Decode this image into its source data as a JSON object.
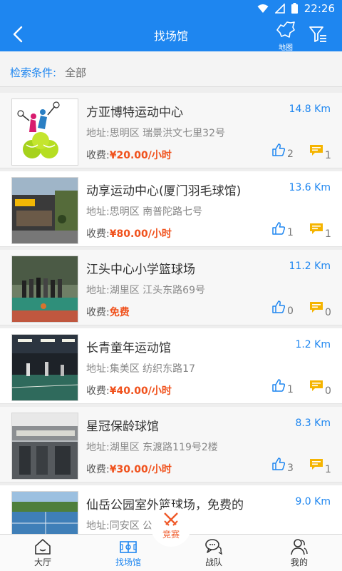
{
  "status_bar": {
    "time": "22:26",
    "icons": [
      "wifi-icon",
      "signal-icon",
      "battery-icon"
    ]
  },
  "header": {
    "title": "找场馆",
    "map_label": "地图",
    "back_icon": "back-arrow-icon",
    "filter_icon": "filter-icon"
  },
  "criteria": {
    "label": "检索条件:",
    "value": "全部"
  },
  "venues": [
    {
      "name": "方亚博特运动中心",
      "distance": "14.8 Km",
      "address": "地址:思明区 瑞景洪文七里32号",
      "fee_label": "收费:",
      "fee": "¥20.00/小时",
      "likes": "2",
      "comments": "1"
    },
    {
      "name": "动享运动中心(厦门羽毛球馆)",
      "distance": "13.6 Km",
      "address": "地址:思明区 南普陀路七号",
      "fee_label": "收费:",
      "fee": "¥80.00/小时",
      "likes": "1",
      "comments": "1"
    },
    {
      "name": "江头中心小学篮球场",
      "distance": "11.2 Km",
      "address": "地址:湖里区 江头东路69号",
      "fee_label": "收费:",
      "fee": "免费",
      "likes": "0",
      "comments": "0"
    },
    {
      "name": "长青童年运动馆",
      "distance": "1.2 Km",
      "address": "地址:集美区 纺织东路17",
      "fee_label": "收费:",
      "fee": "¥40.00/小时",
      "likes": "1",
      "comments": "0"
    },
    {
      "name": "星冠保龄球馆",
      "distance": "8.3 Km",
      "address": "地址:湖里区 东渡路119号2楼",
      "fee_label": "收费:",
      "fee": "¥30.00/小时",
      "likes": "3",
      "comments": "1"
    },
    {
      "name": "仙岳公园室外篮球场，免费的",
      "distance": "9.0 Km",
      "address": "地址:同安区 公",
      "fee_label": "",
      "fee": "",
      "likes": "",
      "comments": ""
    }
  ],
  "tabbar": {
    "tabs": [
      {
        "label": "大厅",
        "icon": "home-icon"
      },
      {
        "label": "找场馆",
        "icon": "venue-icon"
      },
      {
        "label": "战队",
        "icon": "team-chat-icon"
      },
      {
        "label": "我的",
        "icon": "profile-icon"
      }
    ],
    "center_label": "竞赛",
    "active": "找场馆"
  },
  "colors": {
    "primary": "#1e86f0",
    "price": "#f0511c",
    "comment_icon": "#f5b400",
    "fab": "#ef5a2a"
  }
}
